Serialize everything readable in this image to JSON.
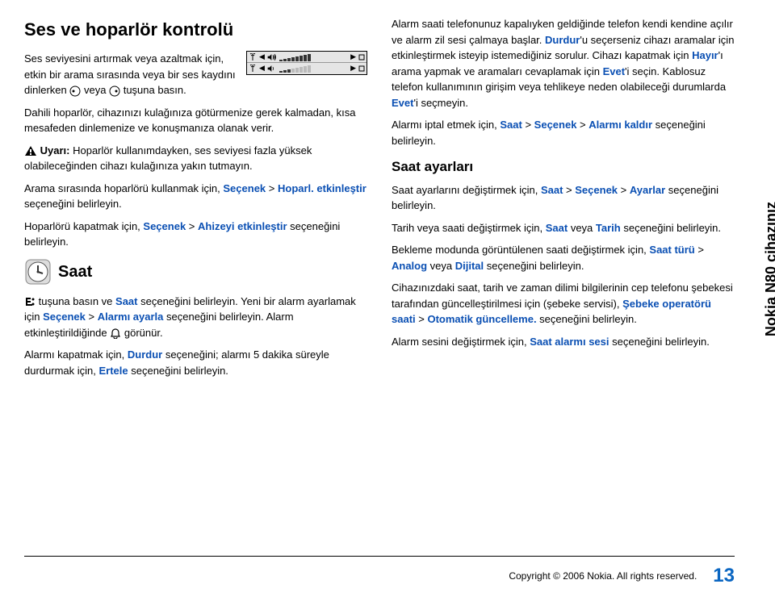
{
  "side_label": "Nokia N80 cihazınız",
  "page_number": "13",
  "copyright": "Copyright © 2006 Nokia. All rights reserved.",
  "left": {
    "h1": "Ses ve hoparlör kontrolü",
    "p1a": "Ses seviyesini artırmak veya azaltmak için, etkin bir arama sırasında veya bir ses kaydını dinlerken ",
    "p1b": " veya ",
    "p1c": " tuşuna basın.",
    "p2": "Dahili hoparlör, cihazınızı kulağınıza götürmenize gerek kalmadan, kısa mesafeden dinlemenize ve konuşmanıza olanak verir.",
    "warn_label": "Uyarı:",
    "warn_body": " Hoparlör kullanımdayken, ses seviyesi fazla yüksek olabileceğinden cihazı kulağınıza yakın tutmayın.",
    "p3a": "Arama sırasında hoparlörü kullanmak için, ",
    "p3_secenek": "Seçenek",
    "p3_gt": " > ",
    "p3_hoparl": "Hoparl. etkinleştir",
    "p3b": " seçeneğini belirleyin.",
    "p4a": "Hoparlörü kapatmak için, ",
    "p4_ahizeyi": "Ahizeyi etkinleştir",
    "p4b": " seçeneğini belirleyin.",
    "h2_saat": "Saat",
    "p5a": "tuşuna basın ve ",
    "p5_saat": "Saat",
    "p5b": " seçeneğini belirleyin. Yeni bir alarm ayarlamak için ",
    "p5_alarm": "Alarmı ayarla",
    "p5c": " seçeneğini belirleyin. Alarm etkinleştirildiğinde ",
    "p5d": " görünür.",
    "p6a": "Alarmı kapatmak için, ",
    "p6_durdur": "Durdur",
    "p6b": " seçeneğini; alarmı 5 dakika süreyle durdurmak için, ",
    "p6_ertele": "Ertele",
    "p6c": " seçeneğini belirleyin."
  },
  "right": {
    "p1a": "Alarm saati telefonunuz kapalıyken geldiğinde telefon kendi kendine açılır ve alarm zil sesi çalmaya başlar. ",
    "p1_durdur": "Durdur",
    "p1b": "'u seçerseniz cihazı aramalar için etkinleştirmek isteyip istemediğiniz sorulur. Cihazı kapatmak için ",
    "p1_hayir": "Hayır",
    "p1c": "'ı arama yapmak ve aramaları cevaplamak için ",
    "p1_evet": "Evet",
    "p1d": "'i seçin. Kablosuz telefon kullanımının girişim veya tehlikeye neden olabileceği durumlarda ",
    "p1e": "'i seçmeyin.",
    "p2a": "Alarmı iptal etmek için, ",
    "p2_saat": "Saat",
    "p2_secenek": "Seçenek",
    "p2_kaldir": "Alarmı kaldır",
    "p2b": " seçeneğini belirleyin.",
    "h3": "Saat ayarları",
    "p3a": "Saat ayarlarını değiştirmek için, ",
    "p3_ayarlar": "Ayarlar",
    "p3b": " seçeneğini belirleyin.",
    "p4a": "Tarih veya saati değiştirmek için, ",
    "p4_saat": "Saat",
    "p4_or": " veya ",
    "p4_tarih": "Tarih",
    "p4b": " seçeneğini belirleyin.",
    "p5a": "Bekleme modunda görüntülenen saati değiştirmek için, ",
    "p5_turu": "Saat türü",
    "p5_analog": "Analog",
    "p5_dijital": "Dijital",
    "p5b": " seçeneğini belirleyin.",
    "p6a": "Cihazınızdaki saat, tarih ve zaman dilimi bilgilerinin cep telefonu şebekesi tarafından güncelleştirilmesi için (şebeke servisi), ",
    "p6_sebeke": "Şebeke operatörü saati",
    "p6_oto": "Otomatik güncelleme.",
    "p6b": " seçeneğini belirleyin.",
    "p7a": "Alarm sesini değiştirmek için, ",
    "p7_alarm": "Saat alarmı sesi",
    "p7b": " seçeneğini belirleyin."
  }
}
